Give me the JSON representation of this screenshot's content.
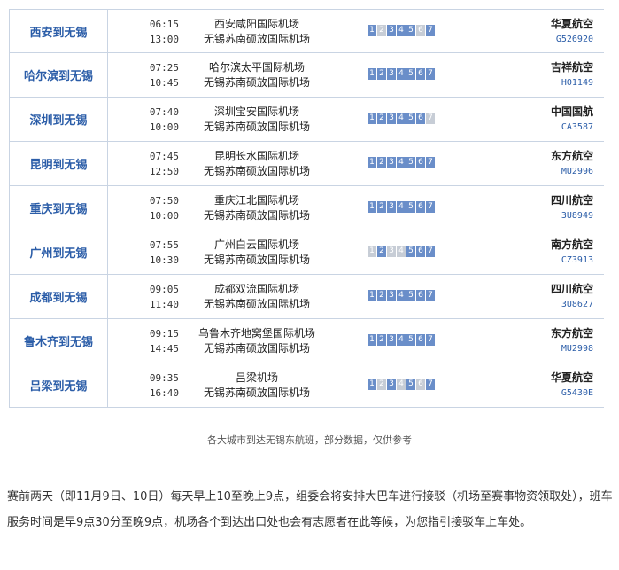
{
  "flights": [
    {
      "route": "西安到无锡",
      "dep": "06:15",
      "arr": "13:00",
      "from": "西安咸阳国际机场",
      "to": "无锡苏南硕放国际机场",
      "days": [
        1,
        0,
        1,
        1,
        1,
        0,
        1
      ],
      "airline": "华夏航空",
      "code": "G526920"
    },
    {
      "route": "哈尔滨到无锡",
      "dep": "07:25",
      "arr": "10:45",
      "from": "哈尔滨太平国际机场",
      "to": "无锡苏南硕放国际机场",
      "days": [
        1,
        1,
        1,
        1,
        1,
        1,
        1
      ],
      "airline": "吉祥航空",
      "code": "HO1149"
    },
    {
      "route": "深圳到无锡",
      "dep": "07:40",
      "arr": "10:00",
      "from": "深圳宝安国际机场",
      "to": "无锡苏南硕放国际机场",
      "days": [
        1,
        1,
        1,
        1,
        1,
        1,
        0
      ],
      "airline": "中国国航",
      "code": "CA3587"
    },
    {
      "route": "昆明到无锡",
      "dep": "07:45",
      "arr": "12:50",
      "from": "昆明长水国际机场",
      "to": "无锡苏南硕放国际机场",
      "days": [
        1,
        1,
        1,
        1,
        1,
        1,
        1
      ],
      "airline": "东方航空",
      "code": "MU2996"
    },
    {
      "route": "重庆到无锡",
      "dep": "07:50",
      "arr": "10:00",
      "from": "重庆江北国际机场",
      "to": "无锡苏南硕放国际机场",
      "days": [
        1,
        1,
        1,
        1,
        1,
        1,
        1
      ],
      "airline": "四川航空",
      "code": "3U8949"
    },
    {
      "route": "广州到无锡",
      "dep": "07:55",
      "arr": "10:30",
      "from": "广州白云国际机场",
      "to": "无锡苏南硕放国际机场",
      "days": [
        0,
        1,
        0,
        0,
        1,
        1,
        1
      ],
      "airline": "南方航空",
      "code": "CZ3913"
    },
    {
      "route": "成都到无锡",
      "dep": "09:05",
      "arr": "11:40",
      "from": "成都双流国际机场",
      "to": "无锡苏南硕放国际机场",
      "days": [
        1,
        1,
        1,
        1,
        1,
        1,
        1
      ],
      "airline": "四川航空",
      "code": "3U8627"
    },
    {
      "route": "鲁木齐到无锡",
      "dep": "09:15",
      "arr": "14:45",
      "from": "乌鲁木齐地窝堡国际机场",
      "to": "无锡苏南硕放国际机场",
      "days": [
        1,
        1,
        1,
        1,
        1,
        1,
        1
      ],
      "airline": "东方航空",
      "code": "MU2998"
    },
    {
      "route": "吕梁到无锡",
      "dep": "09:35",
      "arr": "16:40",
      "from": "吕梁机场",
      "to": "无锡苏南硕放国际机场",
      "days": [
        1,
        0,
        1,
        0,
        1,
        0,
        1
      ],
      "airline": "华夏航空",
      "code": "G5430E"
    }
  ],
  "caption": "各大城市到达无锡东航班，部分数据，仅供参考",
  "paragraph": "赛前两天（即11月9日、10日）每天早上10至晚上9点，组委会将安排大巴车进行接驳（机场至赛事物资领取处），班车服务时间是早9点30分至晚9点，机场各个到达出口处也会有志愿者在此等候，为您指引接驳车上车处。"
}
